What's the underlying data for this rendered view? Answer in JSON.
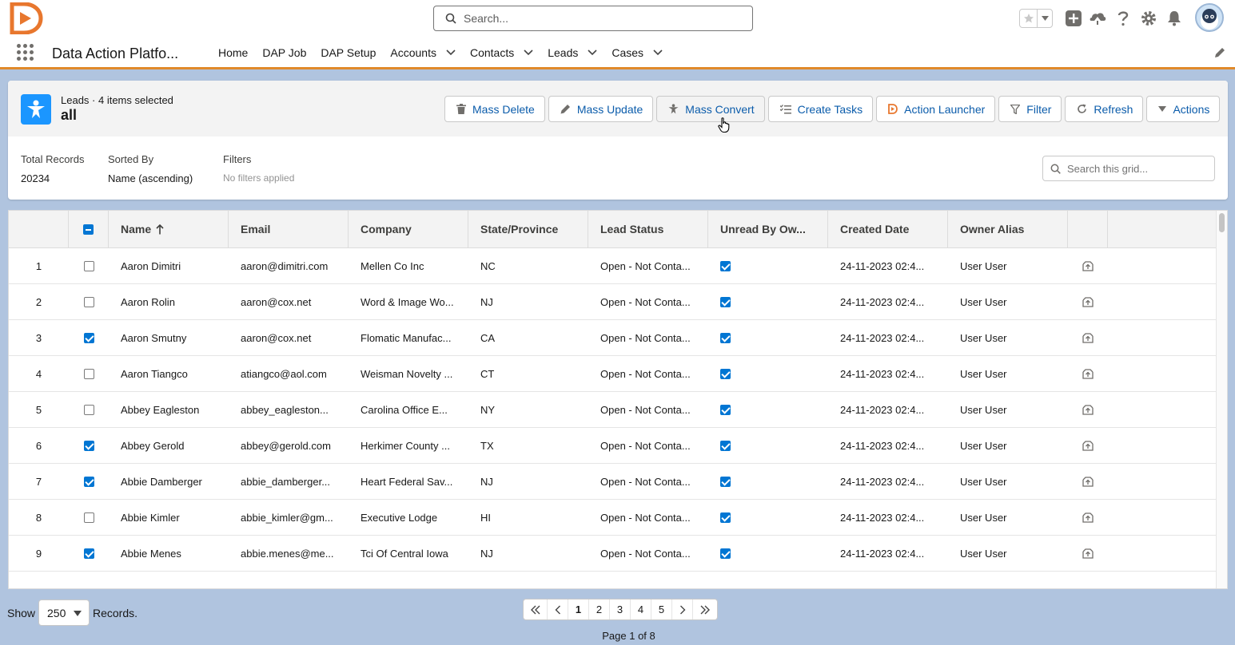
{
  "header": {
    "search_placeholder": "Search..."
  },
  "nav": {
    "app_name": "Data Action Platfo...",
    "items": [
      {
        "label": "Home",
        "dropdown": false
      },
      {
        "label": "DAP Job",
        "dropdown": false
      },
      {
        "label": "DAP Setup",
        "dropdown": false
      },
      {
        "label": "Accounts",
        "dropdown": true
      },
      {
        "label": "Contacts",
        "dropdown": true
      },
      {
        "label": "Leads",
        "dropdown": true
      },
      {
        "label": "Cases",
        "dropdown": true
      }
    ]
  },
  "page": {
    "object_label": "Leads · 4 items selected",
    "list_name": "all",
    "buttons": {
      "mass_delete": "Mass Delete",
      "mass_update": "Mass Update",
      "mass_convert": "Mass Convert",
      "create_tasks": "Create Tasks",
      "action_launcher": "Action Launcher",
      "filter": "Filter",
      "refresh": "Refresh",
      "actions": "Actions"
    },
    "meta": {
      "total_records_label": "Total Records",
      "total_records": "20234",
      "sorted_by_label": "Sorted By",
      "sorted_by": "Name (ascending)",
      "filters_label": "Filters",
      "filters": "No filters applied"
    },
    "grid_search_placeholder": "Search this grid..."
  },
  "grid": {
    "columns": {
      "name": "Name",
      "email": "Email",
      "company": "Company",
      "state": "State/Province",
      "status": "Lead Status",
      "unread": "Unread By Ow...",
      "created": "Created Date",
      "owner": "Owner Alias"
    },
    "rows": [
      {
        "num": "1",
        "selected": false,
        "name": "Aaron Dimitri",
        "email": "aaron@dimitri.com",
        "company": "Mellen Co Inc",
        "state": "NC",
        "status": "Open - Not Conta...",
        "unread": true,
        "created": "24-11-2023 02:4...",
        "owner": "User User"
      },
      {
        "num": "2",
        "selected": false,
        "name": "Aaron Rolin",
        "email": "aaron@cox.net",
        "company": "Word & Image Wo...",
        "state": "NJ",
        "status": "Open - Not Conta...",
        "unread": true,
        "created": "24-11-2023 02:4...",
        "owner": "User User"
      },
      {
        "num": "3",
        "selected": true,
        "name": "Aaron Smutny",
        "email": "aaron@cox.net",
        "company": "Flomatic Manufac...",
        "state": "CA",
        "status": "Open - Not Conta...",
        "unread": true,
        "created": "24-11-2023 02:4...",
        "owner": "User User"
      },
      {
        "num": "4",
        "selected": false,
        "name": "Aaron Tiangco",
        "email": "atiangco@aol.com",
        "company": "Weisman Novelty ...",
        "state": "CT",
        "status": "Open - Not Conta...",
        "unread": true,
        "created": "24-11-2023 02:4...",
        "owner": "User User"
      },
      {
        "num": "5",
        "selected": false,
        "name": "Abbey Eagleston",
        "email": "abbey_eagleston...",
        "company": "Carolina Office E...",
        "state": "NY",
        "status": "Open - Not Conta...",
        "unread": true,
        "created": "24-11-2023 02:4...",
        "owner": "User User"
      },
      {
        "num": "6",
        "selected": true,
        "name": "Abbey Gerold",
        "email": "abbey@gerold.com",
        "company": "Herkimer County ...",
        "state": "TX",
        "status": "Open - Not Conta...",
        "unread": true,
        "created": "24-11-2023 02:4...",
        "owner": "User User"
      },
      {
        "num": "7",
        "selected": true,
        "name": "Abbie Damberger",
        "email": "abbie_damberger...",
        "company": "Heart Federal Sav...",
        "state": "NJ",
        "status": "Open - Not Conta...",
        "unread": true,
        "created": "24-11-2023 02:4...",
        "owner": "User User"
      },
      {
        "num": "8",
        "selected": false,
        "name": "Abbie Kimler",
        "email": "abbie_kimler@gm...",
        "company": "Executive Lodge",
        "state": "HI",
        "status": "Open - Not Conta...",
        "unread": true,
        "created": "24-11-2023 02:4...",
        "owner": "User User"
      },
      {
        "num": "9",
        "selected": true,
        "name": "Abbie Menes",
        "email": "abbie.menes@me...",
        "company": "Tci Of Central Iowa",
        "state": "NJ",
        "status": "Open - Not Conta...",
        "unread": true,
        "created": "24-11-2023 02:4...",
        "owner": "User User"
      }
    ]
  },
  "footer": {
    "show_label": "Show",
    "page_size": "250",
    "records_label": "Records.",
    "pages": [
      "1",
      "2",
      "3",
      "4",
      "5"
    ],
    "current_page": "1",
    "page_of": "Page 1 of 8"
  },
  "colors": {
    "brand_orange": "#e0892a",
    "link_blue": "#0b5cab",
    "checkbox_blue": "#0176d3",
    "object_icon_blue": "#1b96ff",
    "background": "#b0c4df"
  }
}
